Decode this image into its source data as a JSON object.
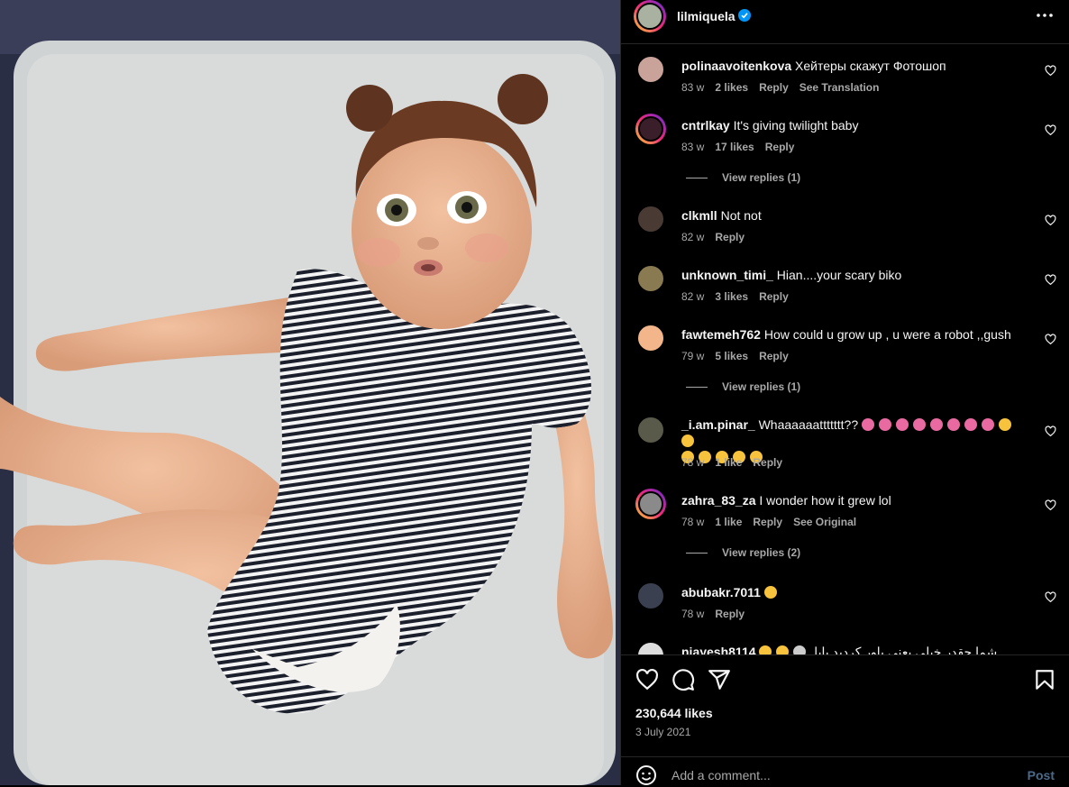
{
  "post": {
    "username": "lilmiquela",
    "likes": "230,644 likes",
    "date": "3 July 2021",
    "add_comment_placeholder": "Add a comment...",
    "post_label": "Post"
  },
  "comments": [
    {
      "user": "polinaavoitenkova",
      "text": "Хейтеры скажут Фотошоп",
      "time": "83 w",
      "likes": "2 likes",
      "reply": "Reply",
      "extra": "See Translation"
    },
    {
      "user": "cntrlkay",
      "text": "It's giving twilight baby",
      "time": "83 w",
      "likes": "17 likes",
      "reply": "Reply",
      "view_replies": "View replies (1)"
    },
    {
      "user": "clkmll",
      "text": "Not not",
      "time": "82 w",
      "reply": "Reply"
    },
    {
      "user": "unknown_timi_",
      "text": "Hian....your scary biko",
      "time": "82 w",
      "likes": "3 likes",
      "reply": "Reply"
    },
    {
      "user": "fawtemeh762",
      "text": "How could u grow up , u were a robot ,,gush",
      "time": "79 w",
      "likes": "5 likes",
      "reply": "Reply",
      "view_replies": "View replies (1)"
    },
    {
      "user": "_i.am.pinar_",
      "text": "Whaaaaaattttttt??",
      "time": "78 w",
      "likes": "1 like",
      "reply": "Reply"
    },
    {
      "user": "zahra_83_za",
      "text": "I wonder how it grew lol",
      "time": "78 w",
      "likes": "1 like",
      "reply": "Reply",
      "extra": "See Original",
      "view_replies": "View replies (2)"
    },
    {
      "user": "abubakr.7011",
      "text": "",
      "time": "78 w",
      "reply": "Reply"
    },
    {
      "user": "niayesh8114",
      "text": "شما چقدر خیلی یعنی باور کردید بابا"
    }
  ],
  "colors": {
    "accent_blue": "#0095f6",
    "muted": "#a8a8a8",
    "emoji_yellow": "#f7c23c",
    "emoji_pink": "#e96aa0"
  }
}
